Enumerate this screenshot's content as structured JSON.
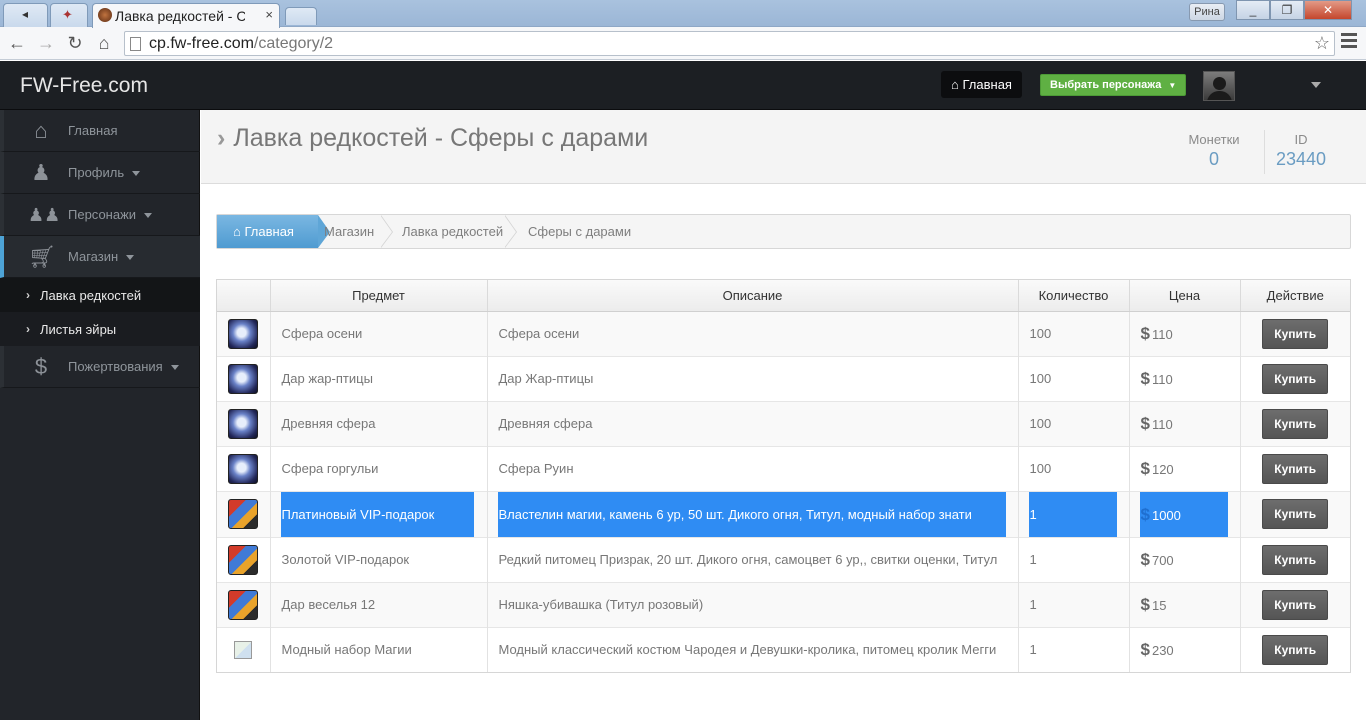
{
  "browser": {
    "tab_title": "Лавка редкостей - С",
    "tab_close": "×",
    "profile_name": "Рина",
    "url_host": "cp.fw-free.com",
    "url_path": "/category/2",
    "win_min": "_",
    "win_max": "❐",
    "win_close": "✕"
  },
  "header": {
    "brand": "FW-Free.com",
    "home_label": "Главная",
    "select_character_label": "Выбрать персонажа"
  },
  "sidebar": {
    "items": [
      {
        "label": "Главная",
        "icon": "home-icon",
        "has_caret": false
      },
      {
        "label": "Профиль",
        "icon": "user-icon",
        "has_caret": true
      },
      {
        "label": "Персонажи",
        "icon": "group-icon",
        "has_caret": true
      },
      {
        "label": "Магазин",
        "icon": "cart-icon",
        "has_caret": true
      },
      {
        "label": "Пожертвования",
        "icon": "dollar-icon",
        "has_caret": true
      }
    ],
    "subitems": [
      {
        "label": "Лавка редкостей",
        "active": true
      },
      {
        "label": "Листья эйры",
        "active": false
      }
    ]
  },
  "page": {
    "title": "Лавка редкостей - Сферы с дарами",
    "coins_label": "Монетки",
    "coins_value": "0",
    "id_label": "ID",
    "id_value": "23440"
  },
  "breadcrumb": [
    "Главная",
    "Магазин",
    "Лавка редкостей",
    "Сферы с дарами"
  ],
  "table": {
    "headers": [
      "",
      "Предмет",
      "Описание",
      "Количество",
      "Цена",
      "Действие"
    ],
    "buy_label": "Купить",
    "currency_symbol": "$",
    "rows": [
      {
        "icon": "orb",
        "name": "Сфера осени",
        "desc": "Сфера осени",
        "qty": "100",
        "price": "110",
        "selected": false
      },
      {
        "icon": "orb",
        "name": "Дар жар-птицы",
        "desc": "Дар Жар-птицы",
        "qty": "100",
        "price": "110",
        "selected": false
      },
      {
        "icon": "orb",
        "name": "Древняя сфера",
        "desc": "Древняя сфера",
        "qty": "100",
        "price": "110",
        "selected": false
      },
      {
        "icon": "orb",
        "name": "Сфера горгульи",
        "desc": "Сфера Руин",
        "qty": "100",
        "price": "120",
        "selected": false
      },
      {
        "icon": "gift",
        "name": "Платиновый VIP-подарок",
        "desc": "Властелин магии, камень 6 ур, 50 шт. Дикого огня, Титул, модный набор знати",
        "qty": "1",
        "price": "1000",
        "selected": true
      },
      {
        "icon": "gift",
        "name": "Золотой VIP-подарок",
        "desc": "Редкий питомец Призрак, 20 шт. Дикого огня, самоцвет 6 ур,, свитки оценки, Титул",
        "qty": "1",
        "price": "700",
        "selected": false
      },
      {
        "icon": "gift",
        "name": "Дар веселья 12",
        "desc": "Няшка-убивашка (Титул розовый)",
        "qty": "1",
        "price": "15",
        "selected": false
      },
      {
        "icon": "broken",
        "name": "Модный набор Магии",
        "desc": "Модный классический костюм Чародея и Девушки-кролика, питомец кролик Мегги",
        "qty": "1",
        "price": "230",
        "selected": false
      }
    ]
  },
  "colors": {
    "accent": "#4f9bd1",
    "selection": "#2f8cf3",
    "header_bg": "#1c1f23",
    "sidebar_bg": "#22252a",
    "green_button": "#5fb043"
  }
}
